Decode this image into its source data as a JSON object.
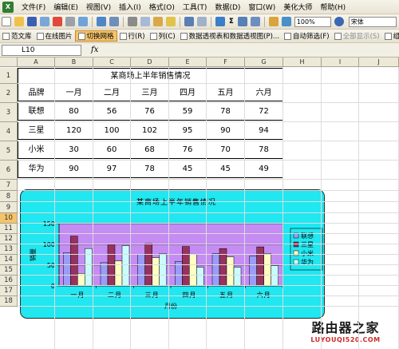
{
  "menu": {
    "items": [
      "文件(F)",
      "编辑(E)",
      "视图(V)",
      "插入(I)",
      "格式(O)",
      "工具(T)",
      "数据(D)",
      "窗口(W)",
      "美化大师",
      "帮助(H)"
    ]
  },
  "toolbar": {
    "zoom": "100%",
    "font": "宋体"
  },
  "toolbar2": {
    "items": [
      "范文库",
      "在线图片",
      "切换网格",
      "行(R)",
      "列(C)",
      "数据透视表和数据透视图(P)...",
      "自动筛选(F)",
      "全部显示(S)",
      "组合(G)..."
    ]
  },
  "formula_bar": {
    "cell_ref": "L10",
    "fx": "fx"
  },
  "sheet": {
    "columns": [
      "A",
      "B",
      "C",
      "D",
      "E",
      "F",
      "G",
      "H",
      "I",
      "J"
    ],
    "rows": [
      "1",
      "2",
      "3",
      "4",
      "5",
      "6",
      "7",
      "8",
      "9",
      "10",
      "11",
      "12",
      "13",
      "14",
      "15",
      "16",
      "17",
      "18"
    ],
    "selected_row": "10"
  },
  "table": {
    "title": "某商场上半年销售情况",
    "header": [
      "品牌",
      "一月",
      "二月",
      "三月",
      "四月",
      "五月",
      "六月"
    ],
    "rows": [
      [
        "联想",
        "80",
        "56",
        "76",
        "59",
        "78",
        "72"
      ],
      [
        "三星",
        "120",
        "100",
        "102",
        "95",
        "90",
        "94"
      ],
      [
        "小米",
        "30",
        "60",
        "68",
        "76",
        "70",
        "78"
      ],
      [
        "华为",
        "90",
        "97",
        "78",
        "45",
        "45",
        "49"
      ]
    ]
  },
  "chart_data": {
    "type": "bar",
    "title": "某商场上半年销售情况",
    "xlabel": "月份",
    "ylabel": "销量",
    "categories": [
      "一月",
      "二月",
      "三月",
      "四月",
      "五月",
      "六月"
    ],
    "ylim": [
      0,
      150
    ],
    "yticks": [
      0,
      50,
      100,
      150
    ],
    "grid": true,
    "legend": "right",
    "series": [
      {
        "name": "联想",
        "color": "#9a9cf7",
        "values": [
          80,
          56,
          76,
          59,
          78,
          72
        ]
      },
      {
        "name": "三星",
        "color": "#97325f",
        "values": [
          120,
          100,
          102,
          95,
          90,
          94
        ]
      },
      {
        "name": "小米",
        "color": "#ffffc4",
        "values": [
          30,
          60,
          68,
          76,
          70,
          78
        ]
      },
      {
        "name": "华为",
        "color": "#c9fbff",
        "values": [
          90,
          97,
          78,
          45,
          45,
          49
        ]
      }
    ],
    "plot_bg": "#c58cf4"
  },
  "watermark": {
    "big": "路由器之家",
    "small": "LUYOUQI520.COM"
  }
}
